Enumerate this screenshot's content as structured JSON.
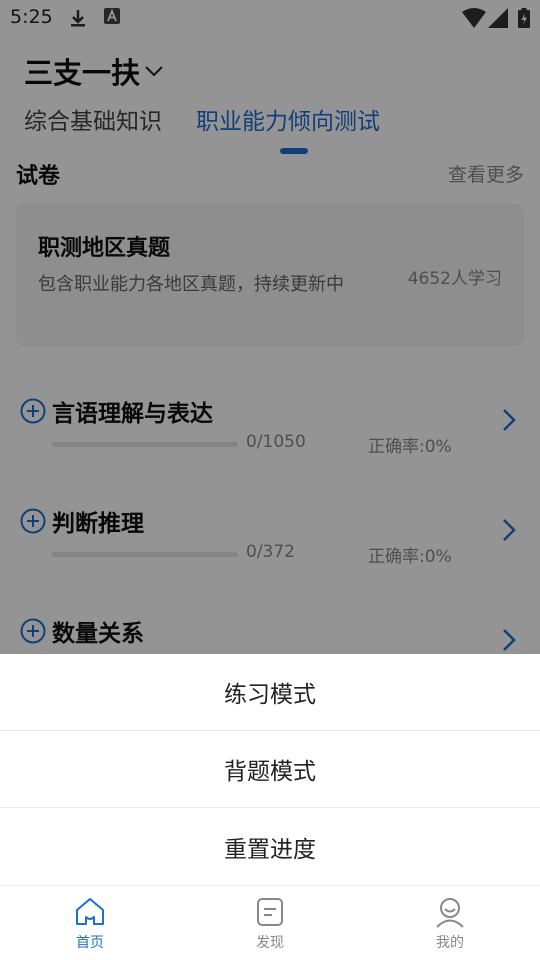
{
  "status_bar": {
    "time": "5:25"
  },
  "header": {
    "subject": "三支一扶",
    "tabs": [
      {
        "label": "综合基础知识",
        "active": false
      },
      {
        "label": "职业能力倾向测试",
        "active": true
      }
    ]
  },
  "content": {
    "section_title": "试卷",
    "more_label": "查看更多",
    "paper": {
      "name": "职测地区真题",
      "description": "包含职业能力各地区真题，持续更新中",
      "learners": "4652人学习"
    },
    "categories": [
      {
        "name": "言语理解与表达",
        "progress": "0/1050",
        "accuracy": "正确率:0%",
        "progress_fraction": 0
      },
      {
        "name": "判断推理",
        "progress": "0/372",
        "accuracy": "正确率:0%",
        "progress_fraction": 0
      },
      {
        "name": "数量关系",
        "progress": "",
        "accuracy": "",
        "progress_fraction": 0
      }
    ]
  },
  "action_sheet": {
    "items": [
      {
        "label": "练习模式"
      },
      {
        "label": "背题模式"
      },
      {
        "label": "重置进度"
      }
    ]
  },
  "bottom_nav": {
    "items": [
      {
        "label": "首页",
        "icon": "home-icon",
        "active": true
      },
      {
        "label": "发现",
        "icon": "discover-icon",
        "active": false
      },
      {
        "label": "我的",
        "icon": "profile-icon",
        "active": false
      }
    ]
  },
  "colors": {
    "accent": "#1e6fcf",
    "overlay": "rgba(0,0,0,0.42)"
  }
}
